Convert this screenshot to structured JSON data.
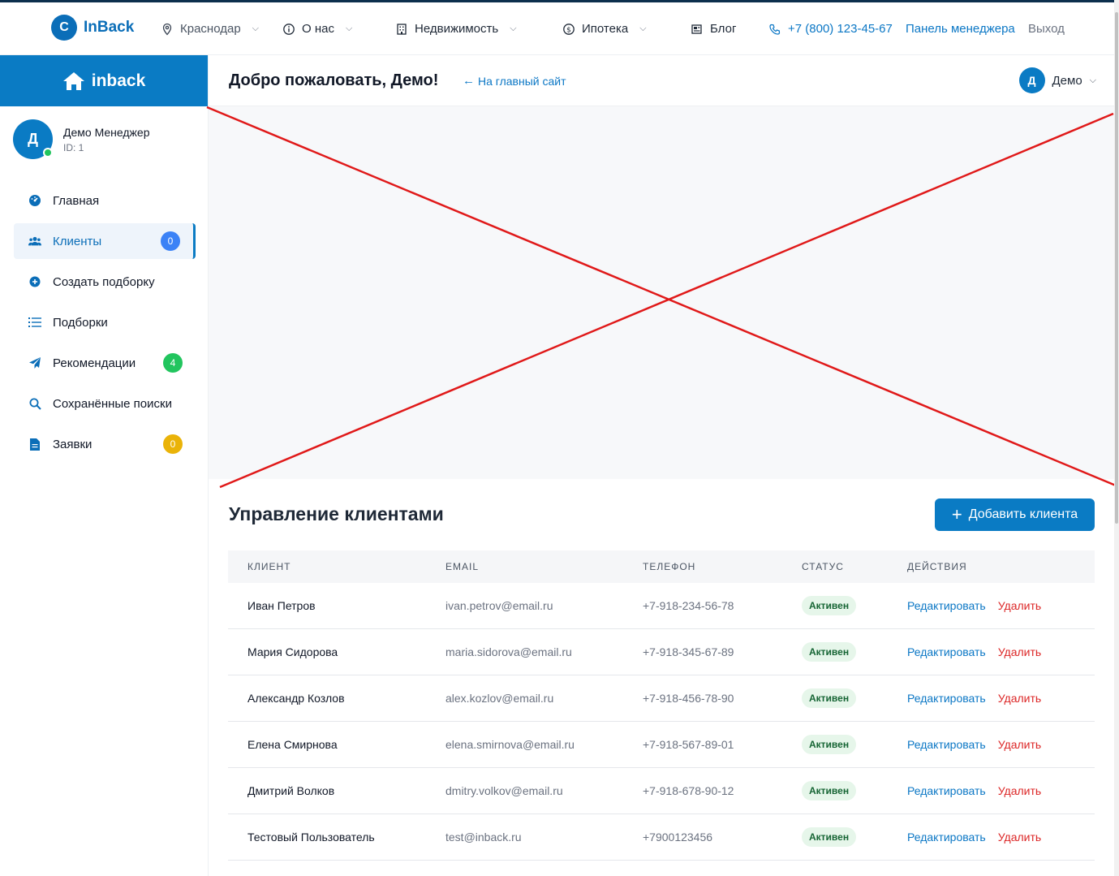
{
  "topnav": {
    "logo_letter": "C",
    "logo_text": "InBack",
    "city": "Краснодар",
    "about": "О нас",
    "realty": "Недвижимость",
    "mortgage": "Ипотека",
    "blog": "Блог",
    "phone": "+7 (800) 123-45-67",
    "manager_panel": "Панель менеджера",
    "logout": "Выход"
  },
  "sidebar": {
    "brand": "inback",
    "user": {
      "initial": "Д",
      "name": "Демо Менеджер",
      "id": "ID: 1"
    },
    "items": [
      {
        "label": "Главная",
        "icon": "dashboard-icon"
      },
      {
        "label": "Клиенты",
        "icon": "users-icon",
        "badge": "0",
        "badge_color": "#3b82f6"
      },
      {
        "label": "Создать подборку",
        "icon": "plus-circle-icon"
      },
      {
        "label": "Подборки",
        "icon": "list-icon"
      },
      {
        "label": "Рекомендации",
        "icon": "send-icon",
        "badge": "4",
        "badge_color": "#22c55e"
      },
      {
        "label": "Сохранённые поиски",
        "icon": "search-icon"
      },
      {
        "label": "Заявки",
        "icon": "document-icon",
        "badge": "0",
        "badge_color": "#eab308"
      }
    ]
  },
  "header": {
    "welcome": "Добро пожаловать, Демо!",
    "back_link": "На главный сайт",
    "user_initial": "Д",
    "user_name": "Демо"
  },
  "clients": {
    "title": "Управление клиентами",
    "add_button": "Добавить клиента",
    "columns": [
      "КЛИЕНТ",
      "EMAIL",
      "ТЕЛЕФОН",
      "СТАТУС",
      "ДЕЙСТВИЯ"
    ],
    "edit_label": "Редактировать",
    "delete_label": "Удалить",
    "rows": [
      {
        "name": "Иван Петров",
        "email": "ivan.petrov@email.ru",
        "phone": "+7-918-234-56-78",
        "status": "Активен"
      },
      {
        "name": "Мария Сидорова",
        "email": "maria.sidorova@email.ru",
        "phone": "+7-918-345-67-89",
        "status": "Активен"
      },
      {
        "name": "Александр Козлов",
        "email": "alex.kozlov@email.ru",
        "phone": "+7-918-456-78-90",
        "status": "Активен"
      },
      {
        "name": "Елена Смирнова",
        "email": "elena.smirnova@email.ru",
        "phone": "+7-918-567-89-01",
        "status": "Активен"
      },
      {
        "name": "Дмитрий Волков",
        "email": "dmitry.volkov@email.ru",
        "phone": "+7-918-678-90-12",
        "status": "Активен"
      },
      {
        "name": "Тестовый Пользователь",
        "email": "test@inback.ru",
        "phone": "+7900123456",
        "status": "Активен"
      }
    ]
  },
  "colors": {
    "accent": "#0a7bc4",
    "link": "#0b77c5",
    "danger": "#dc2626",
    "success_bg": "#e6f6ea",
    "broken_image_line": "#e01919"
  }
}
